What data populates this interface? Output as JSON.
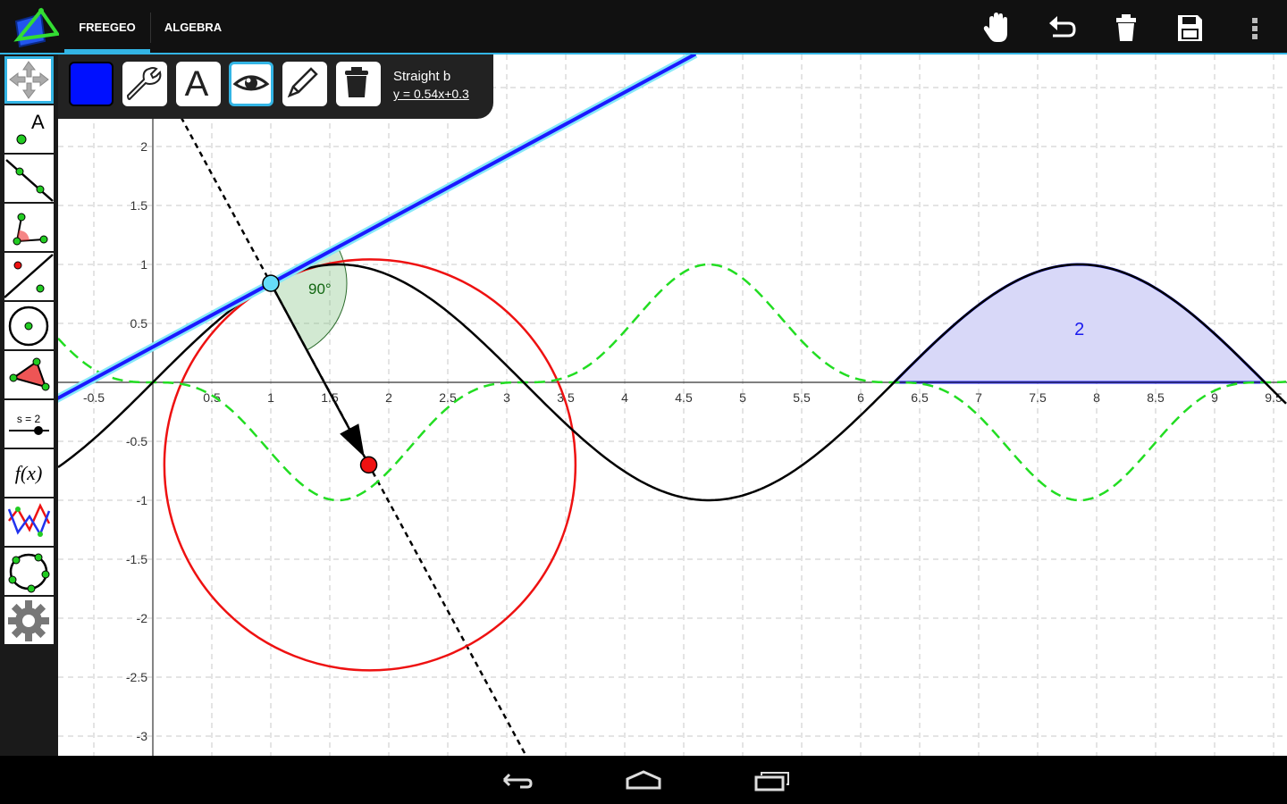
{
  "header": {
    "tabs": [
      {
        "label": "FREEGEO"
      },
      {
        "label": "ALGEBRA"
      }
    ],
    "actions": [
      "hand-icon",
      "undo-icon",
      "trash-icon",
      "save-icon",
      "overflow-menu-icon"
    ]
  },
  "tools": [
    "move-tool",
    "point-tool",
    "line-tool",
    "angle-tool",
    "perpendicular-tool",
    "circle-tool",
    "polygon-tool",
    "slider-tool",
    "function-tool",
    "transform-tool",
    "conic-tool",
    "settings-tool"
  ],
  "tool_labels": {
    "point_letter": "A",
    "slider_text": "s = 2",
    "function_text": "f(x)"
  },
  "properties": {
    "color": "#0010ff",
    "buttons": [
      "color-swatch",
      "wrench-icon",
      "text-style-icon",
      "visibility-eye-icon",
      "pencil-icon",
      "delete-icon"
    ],
    "text_button_glyph": "A",
    "object_name": "Straight b",
    "equation": "y = 0.54x+0.3"
  },
  "graph": {
    "x_ticks": [
      "-0.5",
      "0.5",
      "1",
      "1.5",
      "2",
      "2.5",
      "3",
      "3.5",
      "4",
      "4.5",
      "5",
      "5.5",
      "6",
      "6.5",
      "7",
      "7.5",
      "8",
      "8.5",
      "9",
      "9.5"
    ],
    "y_ticks": [
      "2",
      "1.5",
      "1",
      "0.5",
      "-0.5",
      "-1",
      "-1.5",
      "-2",
      "-2.5",
      "-3"
    ],
    "angle_label": "90°",
    "area_label": "2",
    "colors": {
      "line": "#1a1aff",
      "circle": "#ee1111",
      "sine": "#000000",
      "dashed": "#22dd22",
      "area": "#d8d8f8",
      "highlight": "#88e8f8"
    }
  },
  "nav": [
    "back-icon",
    "home-icon",
    "recent-apps-icon"
  ]
}
